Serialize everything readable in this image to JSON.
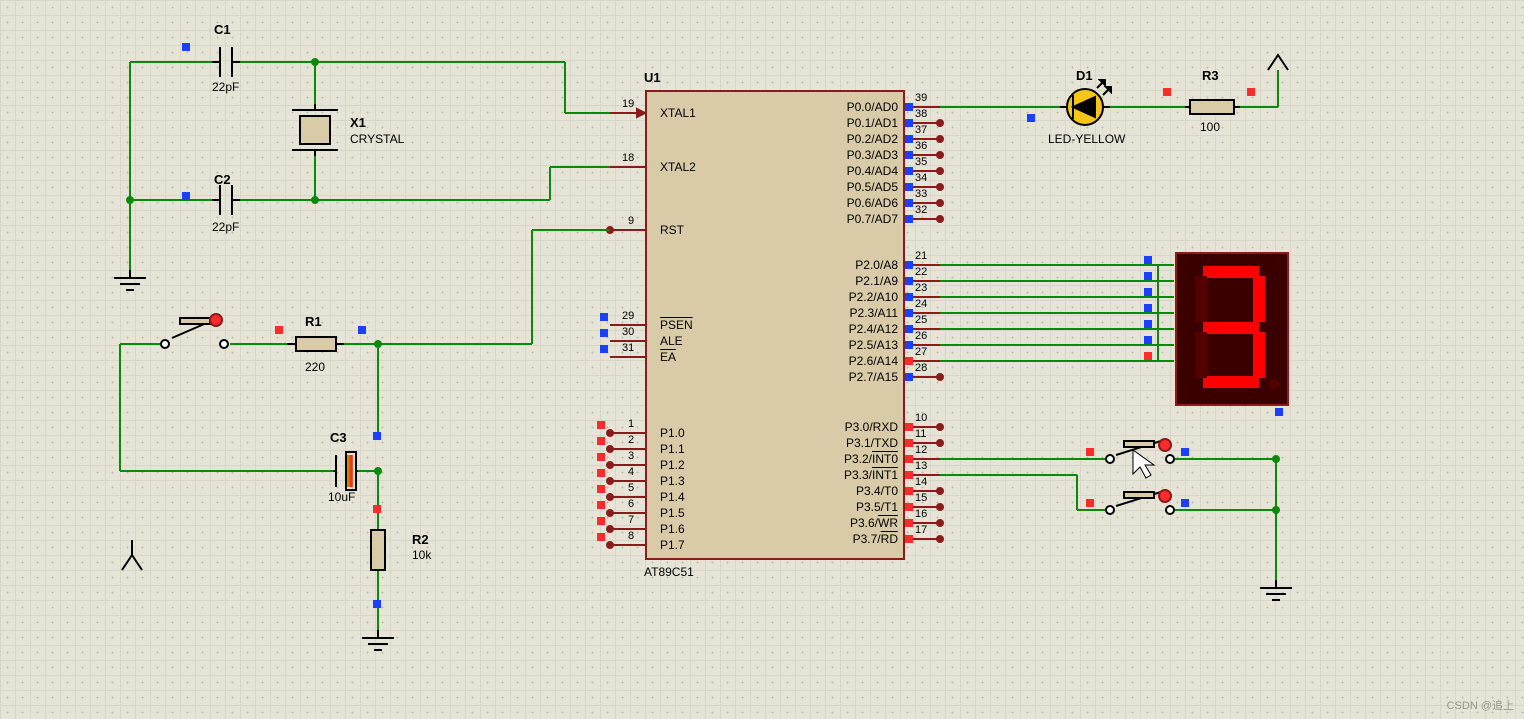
{
  "watermark": "CSDN @追上",
  "ic": {
    "ref": "U1",
    "part": "AT89C51",
    "left_pins": [
      {
        "num": "19",
        "name": "XTAL1"
      },
      {
        "num": "18",
        "name": "XTAL2"
      },
      {
        "num": "9",
        "name": "RST"
      },
      {
        "num": "29",
        "name": "PSEN",
        "over": true
      },
      {
        "num": "30",
        "name": "ALE"
      },
      {
        "num": "31",
        "name": "EA",
        "over": true
      },
      {
        "num": "1",
        "name": "P1.0"
      },
      {
        "num": "2",
        "name": "P1.1"
      },
      {
        "num": "3",
        "name": "P1.2"
      },
      {
        "num": "4",
        "name": "P1.3"
      },
      {
        "num": "5",
        "name": "P1.4"
      },
      {
        "num": "6",
        "name": "P1.5"
      },
      {
        "num": "7",
        "name": "P1.6"
      },
      {
        "num": "8",
        "name": "P1.7"
      }
    ],
    "right_pins": [
      {
        "num": "39",
        "name": "P0.0/AD0"
      },
      {
        "num": "38",
        "name": "P0.1/AD1"
      },
      {
        "num": "37",
        "name": "P0.2/AD2"
      },
      {
        "num": "36",
        "name": "P0.3/AD3"
      },
      {
        "num": "35",
        "name": "P0.4/AD4"
      },
      {
        "num": "34",
        "name": "P0.5/AD5"
      },
      {
        "num": "33",
        "name": "P0.6/AD6"
      },
      {
        "num": "32",
        "name": "P0.7/AD7"
      },
      {
        "num": "21",
        "name": "P2.0/A8"
      },
      {
        "num": "22",
        "name": "P2.1/A9"
      },
      {
        "num": "23",
        "name": "P2.2/A10"
      },
      {
        "num": "24",
        "name": "P2.3/A11"
      },
      {
        "num": "25",
        "name": "P2.4/A12"
      },
      {
        "num": "26",
        "name": "P2.5/A13"
      },
      {
        "num": "27",
        "name": "P2.6/A14"
      },
      {
        "num": "28",
        "name": "P2.7/A15"
      },
      {
        "num": "10",
        "name": "P3.0/RXD"
      },
      {
        "num": "11",
        "name": "P3.1/TXD"
      },
      {
        "num": "12",
        "name": "P3.2/INT0",
        "overpart": "INT0"
      },
      {
        "num": "13",
        "name": "P3.3/INT1",
        "overpart": "INT1"
      },
      {
        "num": "14",
        "name": "P3.4/T0"
      },
      {
        "num": "15",
        "name": "P3.5/T1"
      },
      {
        "num": "16",
        "name": "P3.6/WR",
        "overpart": "WR"
      },
      {
        "num": "17",
        "name": "P3.7/RD",
        "overpart": "RD"
      }
    ]
  },
  "components": {
    "C1": {
      "label": "C1",
      "value": "22pF"
    },
    "C2": {
      "label": "C2",
      "value": "22pF"
    },
    "C3": {
      "label": "C3",
      "value": "10uF"
    },
    "X1": {
      "label": "X1",
      "value": "CRYSTAL"
    },
    "R1": {
      "label": "R1",
      "value": "220"
    },
    "R2": {
      "label": "R2",
      "value": "10k"
    },
    "R3": {
      "label": "R3",
      "value": "100"
    },
    "D1": {
      "label": "D1",
      "value": "LED-YELLOW"
    }
  },
  "seven_segment": {
    "digit": "3"
  },
  "colors": {
    "wire": "#0a8a0a",
    "chip_border": "#8b1a1a",
    "chip_fill": "#d9cba8",
    "led": "#f5c518",
    "seg_fg": "#ff0000",
    "seg_bg": "#3a0000",
    "dot_blue": "#1a3fff",
    "dot_red": "#ff2a2a"
  }
}
